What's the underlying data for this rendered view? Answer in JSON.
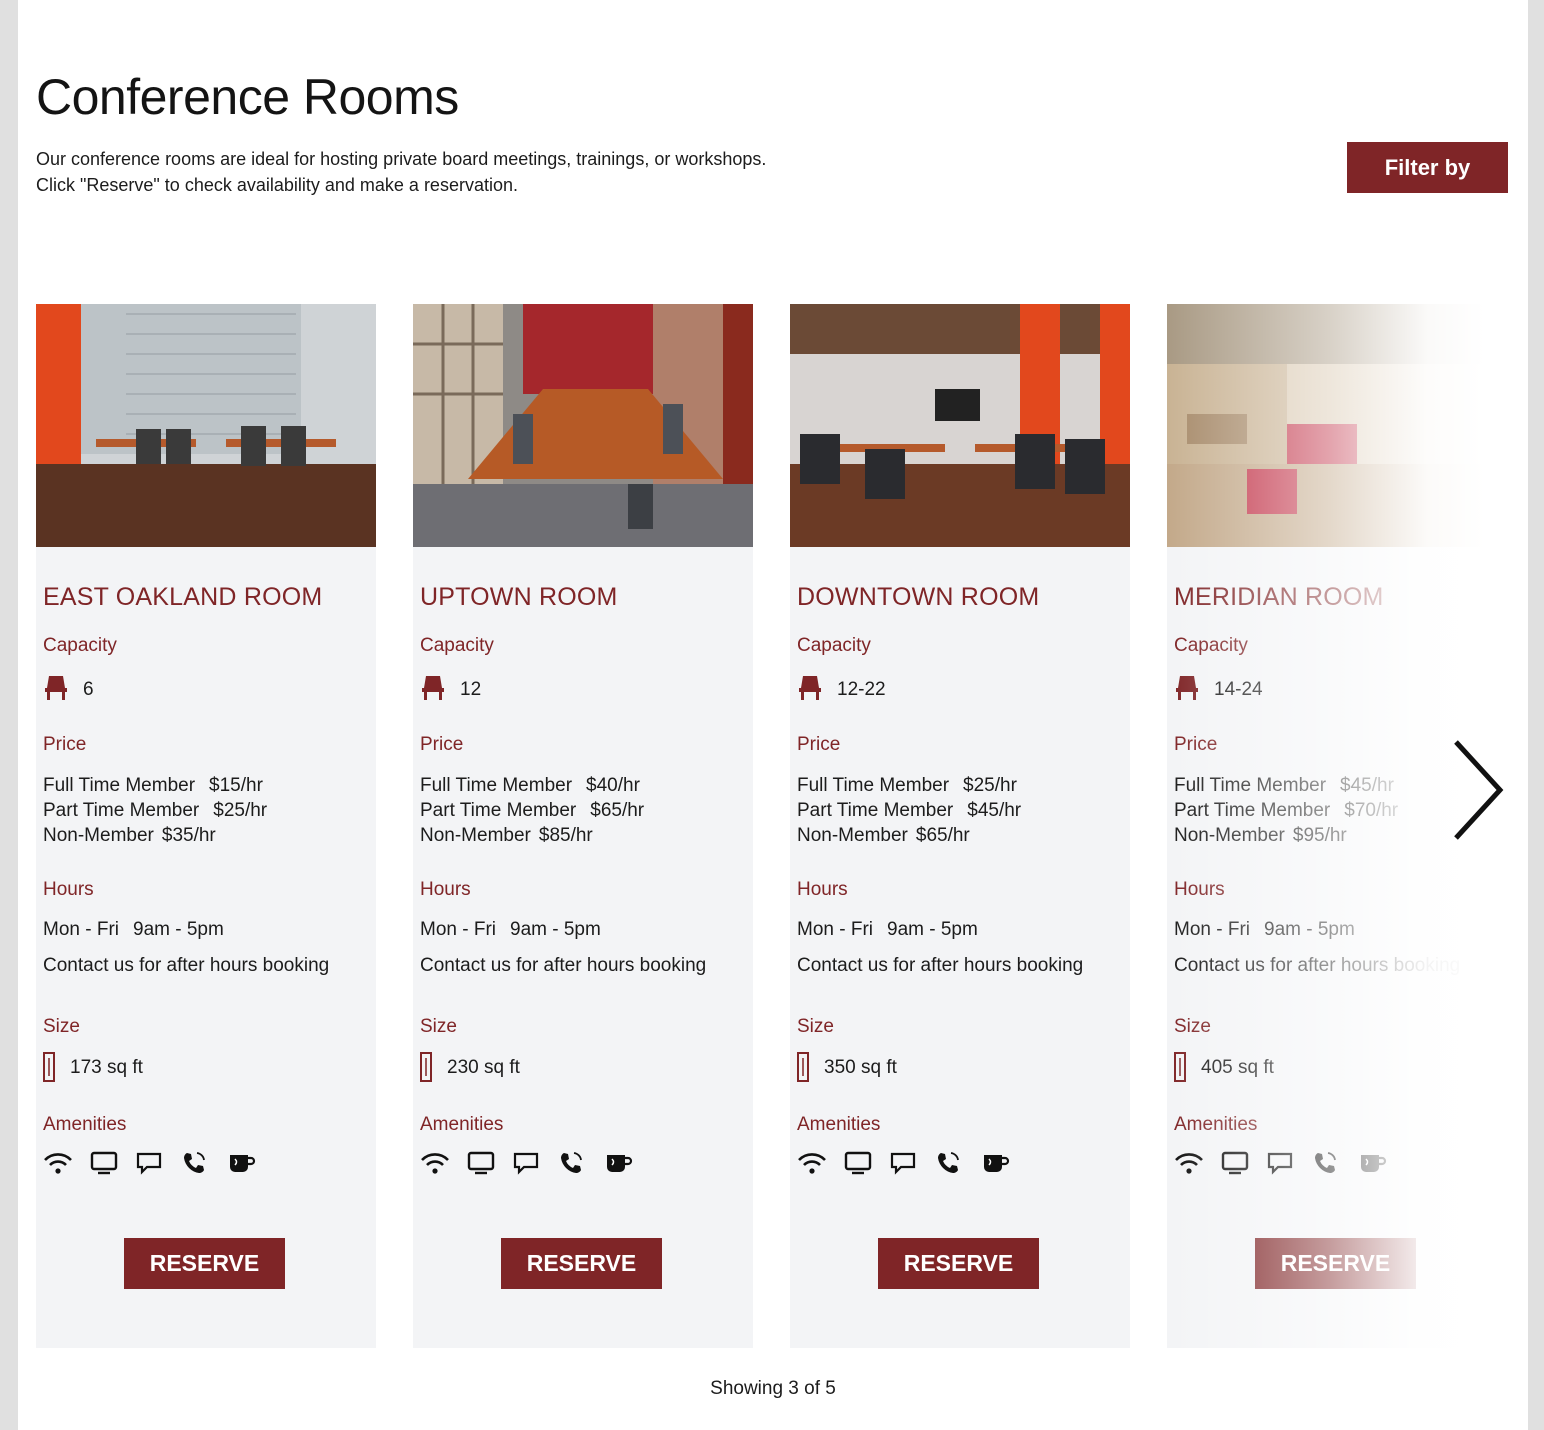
{
  "header": {
    "title": "Conference Rooms",
    "intro_line1": "Our conference rooms are ideal for hosting private board meetings, trainings, or workshops.",
    "intro_line2": "Click \"Reserve\" to check availability and make a reservation.",
    "filter_label": "Filter by"
  },
  "labels": {
    "capacity": "Capacity",
    "price": "Price",
    "hours": "Hours",
    "size": "Size",
    "amenities": "Amenities",
    "reserve": "RESERVE",
    "full_time": "Full Time Member",
    "part_time": "Part Time Member",
    "non_member": "Non-Member",
    "hours_days": "Mon - Fri",
    "hours_times": "9am - 5pm",
    "after_hours": "Contact us for after hours booking"
  },
  "rooms": [
    {
      "name": "EAST OAKLAND ROOM",
      "capacity": "6",
      "full_time": "$15/hr",
      "part_time": "$25/hr",
      "non_member": "$35/hr",
      "size": "173 sq ft"
    },
    {
      "name": "UPTOWN ROOM",
      "capacity": "12",
      "full_time": "$40/hr",
      "part_time": "$65/hr",
      "non_member": "$85/hr",
      "size": "230 sq ft"
    },
    {
      "name": "DOWNTOWN ROOM",
      "capacity": "12-22",
      "full_time": "$25/hr",
      "part_time": "$45/hr",
      "non_member": "$65/hr",
      "size": "350 sq ft"
    },
    {
      "name": "MERIDIAN ROOM",
      "capacity": "14-24",
      "full_time": "$45/hr",
      "part_time": "$70/hr",
      "non_member": "$95/hr",
      "size": "405 sq ft"
    }
  ],
  "amenities": [
    "wifi-icon",
    "monitor-icon",
    "chat-icon",
    "phone-icon",
    "coffee-icon"
  ],
  "footer": {
    "showing": "Showing 3 of 5"
  },
  "colors": {
    "accent": "#7f2527",
    "card_bg": "#f3f4f6"
  }
}
